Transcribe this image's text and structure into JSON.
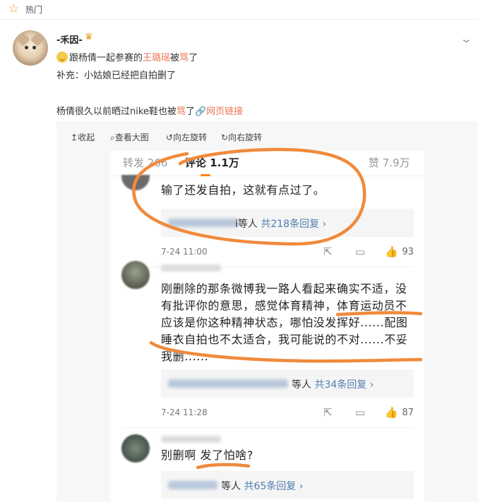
{
  "topbar": {
    "icon": "star-icon",
    "title": "热门"
  },
  "post": {
    "username": "-禾因-",
    "line1_pre": "跟杨倩一起参赛的",
    "line1_name": "王璐瑶",
    "line1_mid": "被",
    "line1_red": "骂",
    "line1_post": "了",
    "line2": "补充：小姑娘已经把自拍删了",
    "line3_pre": "杨倩很久以前晒过nike鞋也被",
    "line3_red": "骂",
    "line3_post": "了",
    "link_label": "网页链接"
  },
  "toolbar": {
    "collapse": "收起",
    "view_large": "查看大图",
    "rotate_left": "向左旋转",
    "rotate_right": "向右旋转"
  },
  "screenshot": {
    "tabs": {
      "repost": "转发 266",
      "comments": "评论 1.1万",
      "likes": "赞 7.9万"
    },
    "comments": [
      {
        "text": "输了还发自拍，这就有点过了。",
        "reply_suffix": "i等人",
        "reply_count": "共218条回复 ›",
        "time": "7-24 11:00",
        "likes": "93"
      },
      {
        "text_lines": [
          "刚删除的那条微博我一路人看起来确实不适，没",
          "有批评你的意思，感觉体育精神，体育运动员不",
          "应该是你这种精神状态，哪怕没发挥好......配图",
          "睡衣自拍也不太适合，我可能说的不对......不妥",
          "我删......"
        ],
        "reply_suffix": "等人",
        "reply_count": "共34条回复 ›",
        "time": "7-24 11:28",
        "likes": "87"
      },
      {
        "text": "别删啊 发了怕啥?",
        "reply_suffix": "等人",
        "reply_count": "共65条回复 ›"
      }
    ]
  },
  "colors": {
    "accent_orange": "#ff8200",
    "link_blue": "#507daf",
    "red_text": "#eb7350",
    "marker": "#f08a3c"
  }
}
